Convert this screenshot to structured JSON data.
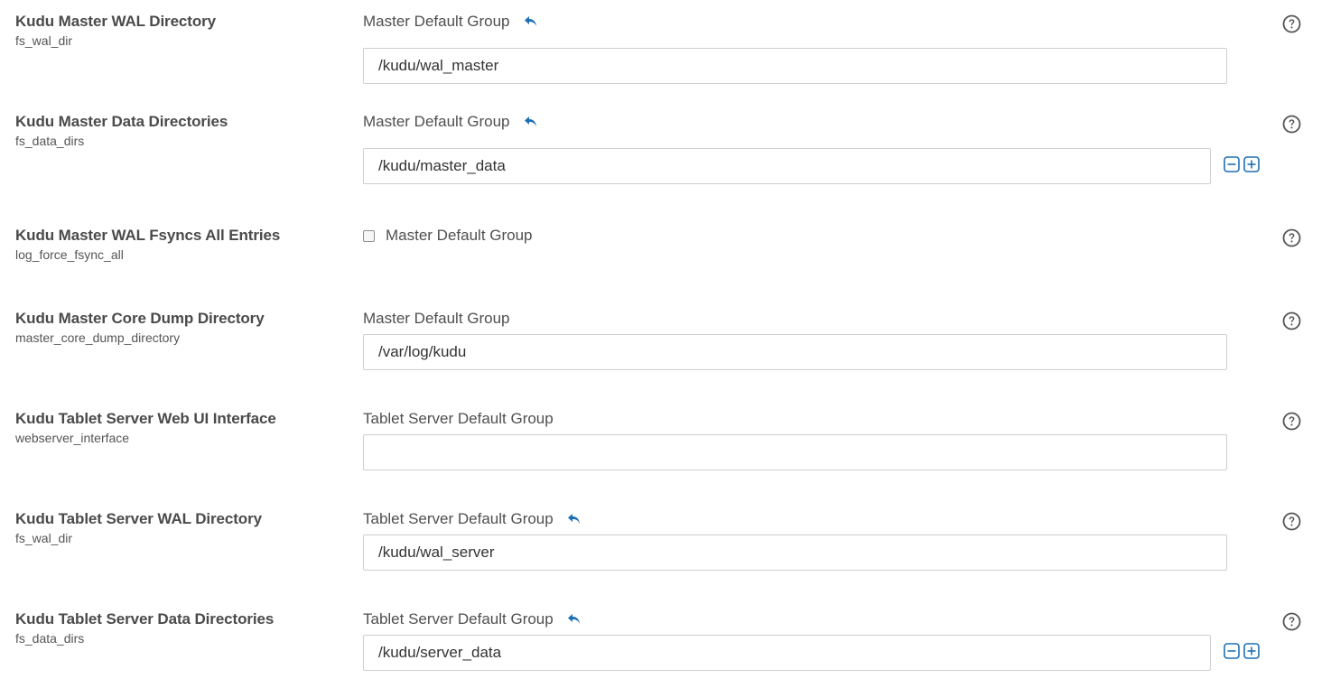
{
  "colors": {
    "accent": "#1f6fb5",
    "border": "#cfcfcf",
    "text": "#4a4a4a"
  },
  "settings": [
    {
      "name": "Kudu Master WAL Directory",
      "key": "fs_wal_dir",
      "group": "Master Default Group",
      "value": "/kudu/wal_master",
      "placeholder": ""
    },
    {
      "name": "Kudu Master Data Directories",
      "key": "fs_data_dirs",
      "group": "Master Default Group",
      "value": "/kudu/master_data",
      "placeholder": ""
    },
    {
      "name": "Kudu Master WAL Fsyncs All Entries",
      "key": "log_force_fsync_all",
      "group": "Master Default Group",
      "checked": false
    },
    {
      "name": "Kudu Master Core Dump Directory",
      "key": "master_core_dump_directory",
      "group": "Master Default Group",
      "value": "/var/log/kudu",
      "placeholder": ""
    },
    {
      "name": "Kudu Tablet Server Web UI Interface",
      "key": "webserver_interface",
      "group": "Tablet Server Default Group",
      "value": "",
      "placeholder": ""
    },
    {
      "name": "Kudu Tablet Server WAL Directory",
      "key": "fs_wal_dir",
      "group": "Tablet Server Default Group",
      "value": "/kudu/wal_server",
      "placeholder": ""
    },
    {
      "name": "Kudu Tablet Server Data Directories",
      "key": "fs_data_dirs",
      "group": "Tablet Server Default Group",
      "value": "/kudu/server_data",
      "placeholder": ""
    }
  ],
  "icons": {
    "revert": "undo-arrow-icon",
    "help": "question-circle-icon",
    "remove": "minus-square-icon",
    "add": "plus-square-icon"
  }
}
